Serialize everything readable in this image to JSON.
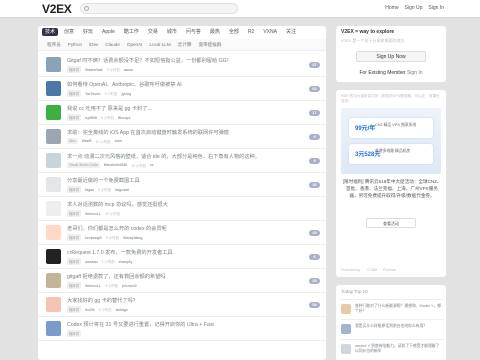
{
  "header": {
    "logo": "V2EX",
    "nav": [
      "Home",
      "Sign Up",
      "Sign In"
    ]
  },
  "tabs": [
    "技术",
    "创意",
    "好玩",
    "Apple",
    "酷工作",
    "交易",
    "城市",
    "问与答",
    "最热",
    "全部",
    "R2",
    "VXNA",
    "关注"
  ],
  "subtabs": [
    "程序员",
    "Python",
    "iDev",
    "Claude",
    "OpenAI",
    "Local LLM",
    "云计算",
    "宽带症候群"
  ],
  "topics": [
    {
      "title": "Gitgaf 时不俩？话费余额没不足？不如短信指公益，一份都别留给 GG！",
      "node": "程序员",
      "author": "StatesGate",
      "time": "5 小时前",
      "reply": "aaron",
      "count": "37",
      "color": "#8aa3b8"
    },
    {
      "title": "如何看待 OpenAI、Anthropic、谷歌呼吁做被禁 AI",
      "node": "程序员",
      "author": "YarSeven",
      "time": "3 小时前",
      "reply": "jyleng",
      "count": "64",
      "color": "#4a78a8"
    },
    {
      "title": "我说 cc 吐用不了 原来是 gg 卡封了...",
      "node": "程序员",
      "author": "nylf898",
      "time": "5 小时前",
      "reply": "Rhoope",
      "count": "17",
      "color": "#3cb043"
    },
    {
      "title": "求助：完全离线的 iOS App 在首次启动键盘时触发系统的联网许可弹窗",
      "node": "iDev",
      "author": "Waaf2",
      "time": "10 小时前",
      "reply": "sixm",
      "count": "4",
      "color": "#9aa7b2"
    },
    {
      "title": "求一点 动漫二次元风格的壁纸，适合 ide 的，大部分是纯色，右下角有人物的这种。",
      "node": "Visual Studio Code",
      "author": "Manoto0x0035",
      "time": "19 小时前",
      "reply": "sc",
      "count": "8",
      "color": "#c9d3dc"
    },
    {
      "title": "分享最近做的一个免费截图工具",
      "node": "程序员",
      "author": "fagan",
      "time": "9 小时前",
      "reply": "bagusall",
      "count": "16",
      "color": "#e3e7ea"
    },
    {
      "title": "求人对话测数的 mcp 协议吗，感觉还挺很大",
      "node": "程序员",
      "author": "SilenceLL",
      "time": "20 小时前",
      "reply": "",
      "count": "",
      "color": "#eee"
    },
    {
      "title": "老哥们，你们都是怎么开的 codex 的会员呢",
      "node": "程序员",
      "author": "keepongl2",
      "time": "9 小时前",
      "reply": "ShirayWang",
      "count": "49",
      "color": "#ffd8c8"
    },
    {
      "title": "crRequest 1.7.0 发布，一款免费的开发者工具",
      "node": "程序员",
      "author": "wansau",
      "time": "1 小时前",
      "reply": "chanpily",
      "count": "6",
      "color": "#222"
    },
    {
      "title": "gitgaff 拒绝退款了，还有救回余额的希望吗",
      "node": "程序员",
      "author": "SilenceLL",
      "time": "9 小时前",
      "reply": "jiecnocl2",
      "count": "35",
      "color": "#c4b49a"
    },
    {
      "title": "大家找好的 gg 卡的替代了吗？",
      "node": "程序员",
      "author": "llv209",
      "time": "5 小时前",
      "reply": "wxlaige",
      "count": "54",
      "color": "#f5c4b5"
    },
    {
      "title": "Codex 预计将在 31 号又要进行重置，记得开启你的 Ultra + Fast",
      "node": "程序员",
      "author": "",
      "time": "",
      "reply": "",
      "count": "",
      "color": "#7a9ccc"
    }
  ],
  "sidebar": {
    "welcome_title": "V2EX = way to explore",
    "welcome_sub": "V2EX 是一个关于分享和探索的地方",
    "signup": "Sign Up Now",
    "existing_prefix": "For Existing Member",
    "signin": "Sign In",
    "ad_note": "RDR 的中大促折扣打折（购的的VPS服务器，可以正，效果也没作）",
    "ad_cards": [
      {
        "price": "99元/年",
        "desc": "CN2 精品 VPS 独享多线"
      },
      {
        "price": "3元528元",
        "desc": "香港多线路 精品机房"
      }
    ],
    "ad_text": "[限时福利] 腾讯云618年中大促活动：全球CN2、首批、香港、法兰克福、上海、广州VPS服务器，另可免费提升取得/升级/数据代金券。",
    "ad_btn": "查看活动",
    "ad_foot": [
      "Promoted by",
      ".V7388",
      "Promote"
    ],
    "today_title": "Today Top 10",
    "today": [
      {
        "text": "各种门能对了什么新能源呢？理想和、Model Y，哪个好？",
        "color": "#e8c9a8"
      },
      {
        "text": "我是买什么样能原话到前台也给你么有用？",
        "color": "#9fb6cf"
      },
      {
        "text": "mode4 Y 到底有啥魅力，读较了下感受才能理解了以同价位的新车",
        "color": "#cfd6de"
      }
    ]
  }
}
